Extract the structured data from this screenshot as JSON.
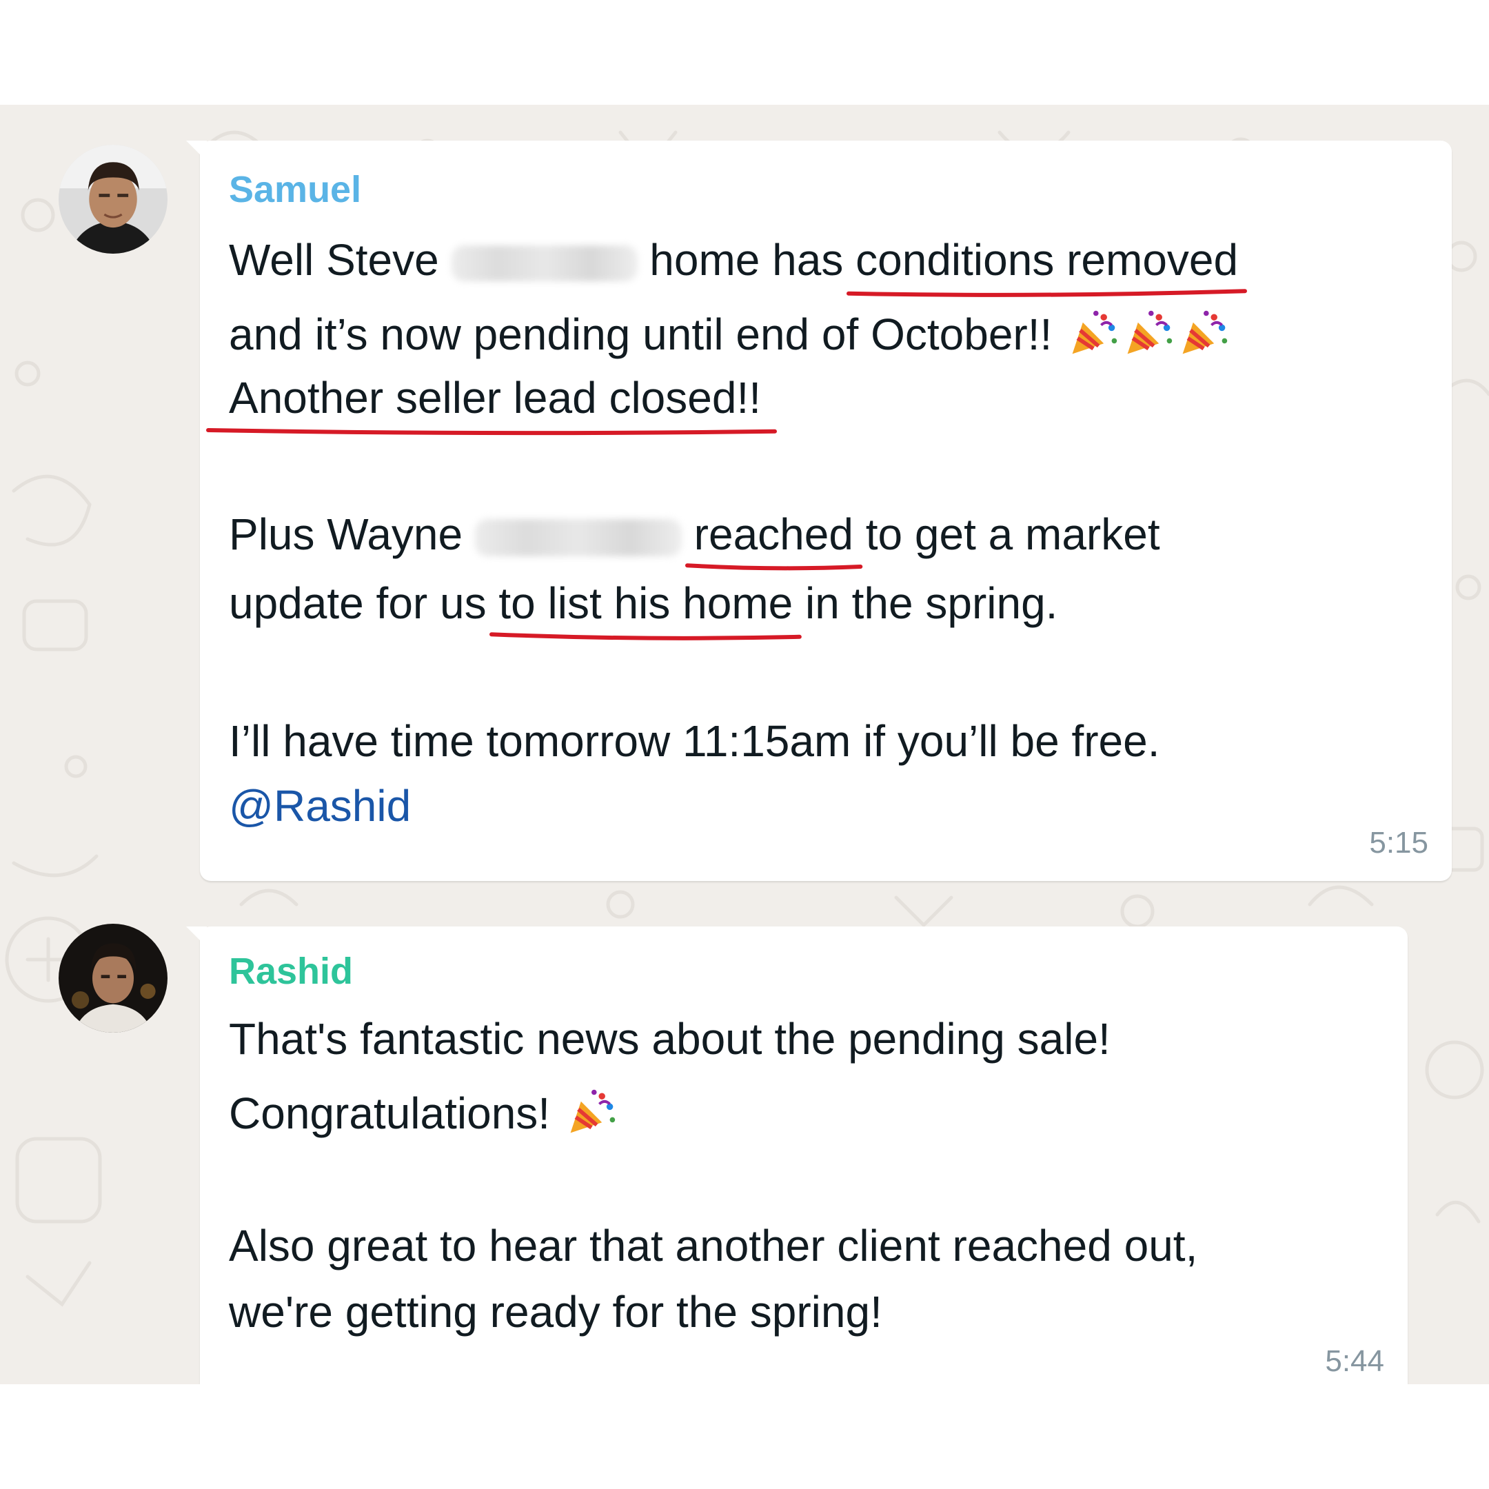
{
  "colors": {
    "chat_bg": "#f1eeea",
    "bubble_bg": "#ffffff",
    "samuel_name": "#5ab4e6",
    "rashid_name": "#2ec49a",
    "mention": "#1a56a8",
    "underline_mark": "#d61a26",
    "timestamp": "#8696a0"
  },
  "messages": [
    {
      "sender": "Samuel",
      "avatar_icon": "man-profile-photo",
      "lines": [
        {
          "a": "Well Steve ",
          "b": " home has ",
          "u": "conditions removed"
        },
        {
          "a": "and it’s now pending until end of October!!"
        },
        {
          "u": "Another seller lead closed!!"
        },
        {
          "a": "Plus Wayne ",
          "u": "reached",
          "b": " to get a market"
        },
        {
          "a": "update for us ",
          "u": "to list his home",
          "b": " in the spring."
        },
        {
          "a": "I’ll have time tomorrow 11:15am if you’ll be free."
        }
      ],
      "mention": "@Rashid",
      "time": "5:15",
      "emoji": [
        "party-popper-icon",
        "party-popper-icon",
        "party-popper-icon"
      ]
    },
    {
      "sender": "Rashid",
      "avatar_icon": "man-profile-photo",
      "lines": [
        {
          "a": "That's fantastic news about the pending sale!"
        },
        {
          "a": "Congratulations!"
        },
        {
          "a": "Also great to hear that another client reached out,"
        },
        {
          "a": "we're getting ready for the spring!"
        }
      ],
      "time": "5:44",
      "emoji": [
        "party-popper-icon"
      ]
    }
  ]
}
